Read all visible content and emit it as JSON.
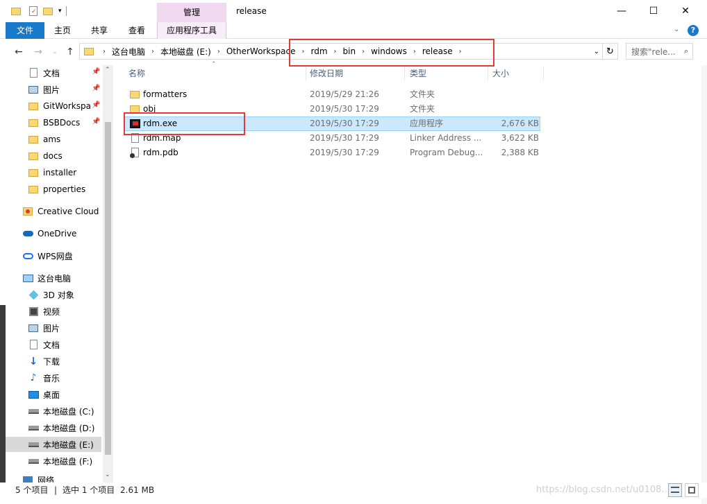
{
  "window": {
    "title": "release",
    "context_tab_header": "管理",
    "minimize": "—",
    "maximize": "☐",
    "close": "✕"
  },
  "ribbon": {
    "tabs": [
      "文件",
      "主页",
      "共享",
      "查看",
      "应用程序工具"
    ],
    "help": "?"
  },
  "address": {
    "path": [
      "这台电脑",
      "本地磁盘 (E:)",
      "OtherWorkspace",
      "rdm",
      "bin",
      "windows",
      "release"
    ],
    "search_placeholder": "搜索\"rele..."
  },
  "sidebar": {
    "items": [
      {
        "label": "文档",
        "icon": "document-icon",
        "pinned": true
      },
      {
        "label": "图片",
        "icon": "picture-icon",
        "pinned": true
      },
      {
        "label": "GitWorkspa",
        "icon": "folder-icon",
        "pinned": true
      },
      {
        "label": "BSBDocs",
        "icon": "folder-icon",
        "pinned": true
      },
      {
        "label": "ams",
        "icon": "folder-icon"
      },
      {
        "label": "docs",
        "icon": "folder-icon"
      },
      {
        "label": "installer",
        "icon": "folder-icon"
      },
      {
        "label": "properties",
        "icon": "folder-icon"
      },
      {
        "label": "Creative Cloud F",
        "icon": "creative-cloud-icon"
      },
      {
        "label": "OneDrive",
        "icon": "onedrive-icon"
      },
      {
        "label": "WPS网盘",
        "icon": "wps-cloud-icon"
      },
      {
        "label": "这台电脑",
        "icon": "computer-icon"
      },
      {
        "label": "3D 对象",
        "icon": "3d-objects-icon"
      },
      {
        "label": "视频",
        "icon": "video-icon"
      },
      {
        "label": "图片",
        "icon": "picture-icon"
      },
      {
        "label": "文档",
        "icon": "document-icon"
      },
      {
        "label": "下载",
        "icon": "download-icon"
      },
      {
        "label": "音乐",
        "icon": "music-icon"
      },
      {
        "label": "桌面",
        "icon": "desktop-icon"
      },
      {
        "label": "本地磁盘 (C:)",
        "icon": "drive-icon"
      },
      {
        "label": "本地磁盘 (D:)",
        "icon": "drive-icon"
      },
      {
        "label": "本地磁盘 (E:)",
        "icon": "drive-icon",
        "selected": true
      },
      {
        "label": "本地磁盘 (F:)",
        "icon": "drive-icon"
      },
      {
        "label": "网络",
        "icon": "network-icon"
      }
    ]
  },
  "filelist": {
    "columns": {
      "name": "名称",
      "modified": "修改日期",
      "type": "类型",
      "size": "大小"
    },
    "files": [
      {
        "name": "formatters",
        "modified": "2019/5/29 21:26",
        "type": "文件夹",
        "size": "",
        "icon": "folder-icon"
      },
      {
        "name": "obj",
        "modified": "2019/5/30 17:29",
        "type": "文件夹",
        "size": "",
        "icon": "folder-icon"
      },
      {
        "name": "rdm.exe",
        "modified": "2019/5/30 17:29",
        "type": "应用程序",
        "size": "2,676 KB",
        "icon": "rdm-app-icon",
        "selected": true
      },
      {
        "name": "rdm.map",
        "modified": "2019/5/30 17:29",
        "type": "Linker Address ...",
        "size": "3,622 KB",
        "icon": "map-file-icon"
      },
      {
        "name": "rdm.pdb",
        "modified": "2019/5/30 17:29",
        "type": "Program Debug...",
        "size": "2,388 KB",
        "icon": "pdb-file-icon"
      }
    ]
  },
  "status": {
    "item_count": "5 个项目",
    "selection": "选中 1 个项目",
    "selection_size": "2.61 MB",
    "watermark": "https://blog.csdn.net/u0108..."
  },
  "colors": {
    "accent": "#1979ca",
    "selection": "#cce8ff",
    "highlight_box": "#e53935",
    "folder": "#f8d775"
  }
}
